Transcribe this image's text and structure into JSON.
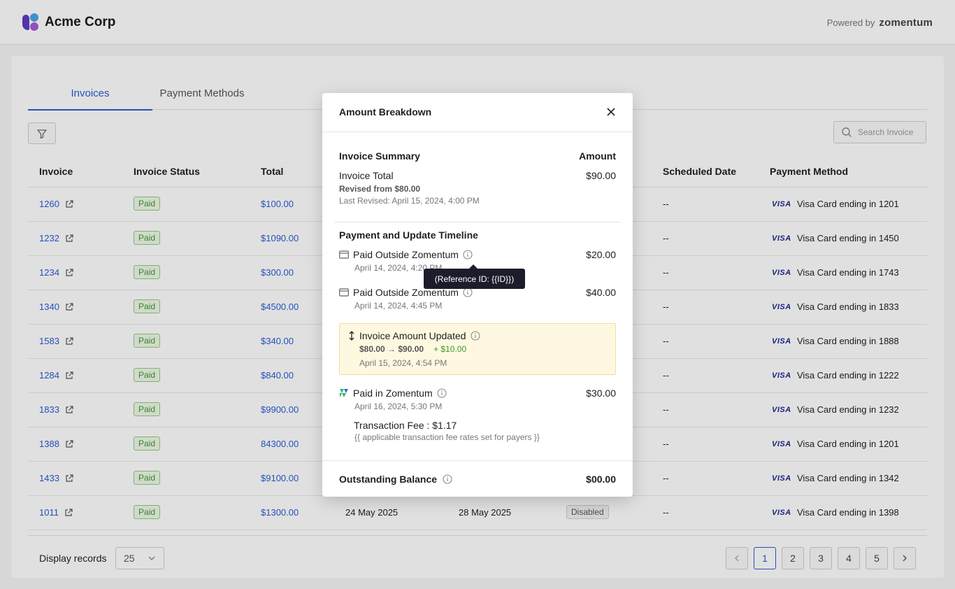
{
  "header": {
    "brand_name": "Acme Corp",
    "powered_label": "Powered by",
    "powered_brand": "zomentum"
  },
  "tabs": [
    {
      "label": "Invoices",
      "active": true
    },
    {
      "label": "Payment Methods",
      "active": false
    }
  ],
  "search": {
    "placeholder": "Search Invoice"
  },
  "table": {
    "columns": [
      "Invoice",
      "Invoice Status",
      "Total",
      "Scheduled Date",
      "Payment Method"
    ],
    "rows": [
      {
        "invoice": "1260",
        "status": "Paid",
        "total": "$100.00",
        "scheduled": "--",
        "card": "Visa Card ending in 1201"
      },
      {
        "invoice": "1232",
        "status": "Paid",
        "total": "$1090.00",
        "scheduled": "--",
        "card": "Visa Card ending in 1450"
      },
      {
        "invoice": "1234",
        "status": "Paid",
        "total": "$300.00",
        "scheduled": "--",
        "card": "Visa Card ending in 1743"
      },
      {
        "invoice": "1340",
        "status": "Paid",
        "total": "$4500.00",
        "scheduled": "--",
        "card": "Visa Card ending in 1833"
      },
      {
        "invoice": "1583",
        "status": "Paid",
        "total": "$340.00",
        "scheduled": "--",
        "card": "Visa Card ending in 1888"
      },
      {
        "invoice": "1284",
        "status": "Paid",
        "total": "$840.00",
        "scheduled": "--",
        "card": "Visa Card ending in 1222"
      },
      {
        "invoice": "1833",
        "status": "Paid",
        "total": "$9900.00",
        "scheduled": "--",
        "card": "Visa Card ending in 1232"
      },
      {
        "invoice": "1388",
        "status": "Paid",
        "total": "84300.00",
        "scheduled": "--",
        "card": "Visa Card ending in 1201"
      },
      {
        "invoice": "1433",
        "status": "Paid",
        "total": "$9100.00",
        "scheduled": "--",
        "card": "Visa Card ending in 1342"
      },
      {
        "invoice": "1011",
        "status": "Paid",
        "total": "$1300.00",
        "date1": "24 May 2025",
        "date2": "28 May 2025",
        "autopay": "Disabled",
        "scheduled": "--",
        "card": "Visa Card ending in 1398"
      }
    ],
    "card_brand": "VISA"
  },
  "footer": {
    "display_label": "Display records",
    "per_page": "25",
    "pages": [
      "1",
      "2",
      "3",
      "4",
      "5"
    ],
    "current_page": "1"
  },
  "modal": {
    "title": "Amount Breakdown",
    "summary_title": "Invoice Summary",
    "amount_header": "Amount",
    "invoice_total_label": "Invoice Total",
    "invoice_total": "$90.00",
    "revised_from": "Revised from $80.00",
    "last_revised": "Last Revised: April 15, 2024, 4:00 PM",
    "timeline_title": "Payment and Update Timeline",
    "entries": [
      {
        "label": "Paid Outside Zomentum",
        "date": "April 14, 2024, 4:20 PM",
        "amount": "$20.00"
      },
      {
        "label": "Paid Outside Zomentum",
        "date": "April 14, 2024, 4:45 PM",
        "amount": "$40.00"
      }
    ],
    "update": {
      "label": "Invoice Amount Updated",
      "change": "$80.00 → $90.00",
      "increase": "+ $10.00",
      "date": "April 15, 2024, 4:54 PM"
    },
    "zomentum_payment": {
      "label": "Paid in Zomentum",
      "date": "April 16, 2024, 5:30 PM",
      "amount": "$30.00",
      "fee": "Transaction Fee : $1.17",
      "fee_note": "{{ applicable transaction fee rates set for payers }}"
    },
    "outstanding_label": "Outstanding Balance",
    "outstanding_value": "$00.00"
  },
  "tooltip": {
    "text": "(Reference ID: {{ID}})"
  },
  "colors": {
    "accent": "#2a5bd7",
    "paid_green": "#3d9a2c",
    "highlight": "#fff8e1"
  }
}
